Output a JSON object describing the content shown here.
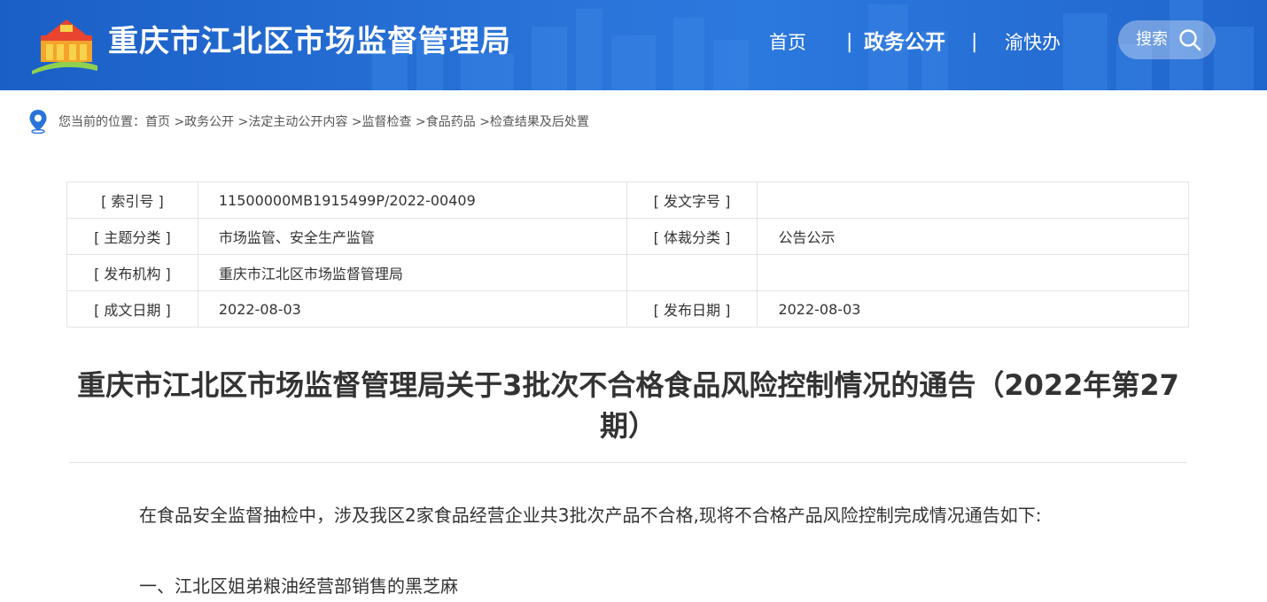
{
  "header": {
    "site_title": "重庆市江北区市场监督管理局",
    "nav": {
      "home": "首页",
      "sep_left": "|",
      "gov": "政务公开",
      "sep_right": "|",
      "yukuaiban": "渝快办"
    },
    "search_label": "搜索"
  },
  "breadcrumb": {
    "prefix": "您当前的位置：",
    "items": [
      "首页",
      ">政务公开",
      ">法定主动公开内容",
      ">监督检查",
      ">食品药品",
      ">检查结果及后处置"
    ]
  },
  "meta": {
    "rows": [
      {
        "l1": "[ 索引号 ]",
        "v1": "11500000MB1915499P/2022-00409",
        "l2": "[ 发文字号 ]",
        "v2": ""
      },
      {
        "l1": "[ 主题分类 ]",
        "v1": "市场监管、安全生产监管",
        "l2": "[ 体裁分类 ]",
        "v2": "公告公示"
      },
      {
        "l1": "[ 发布机构 ]",
        "v1": "重庆市江北区市场监督管理局",
        "l2": "",
        "v2": ""
      },
      {
        "l1": "[ 成文日期 ]",
        "v1": "2022-08-03",
        "l2": "[ 发布日期 ]",
        "v2": "2022-08-03"
      }
    ]
  },
  "article": {
    "title": "重庆市江北区市场监督管理局关于3批次不合格食品风险控制情况的通告（2022年第27期）",
    "paragraphs": [
      "在食品安全监督抽检中，涉及我区2家食品经营企业共3批次产品不合格,现将不合格产品风险控制完成情况通告如下:",
      "一、江北区姐弟粮油经营部销售的黑芝麻"
    ]
  },
  "colors": {
    "header_blue": "#2a74d9",
    "text": "#333333",
    "border": "#e3e3e3"
  },
  "icons": {
    "logo": "gov-building-logo-icon",
    "search": "search-icon",
    "location": "location-pin-icon"
  }
}
